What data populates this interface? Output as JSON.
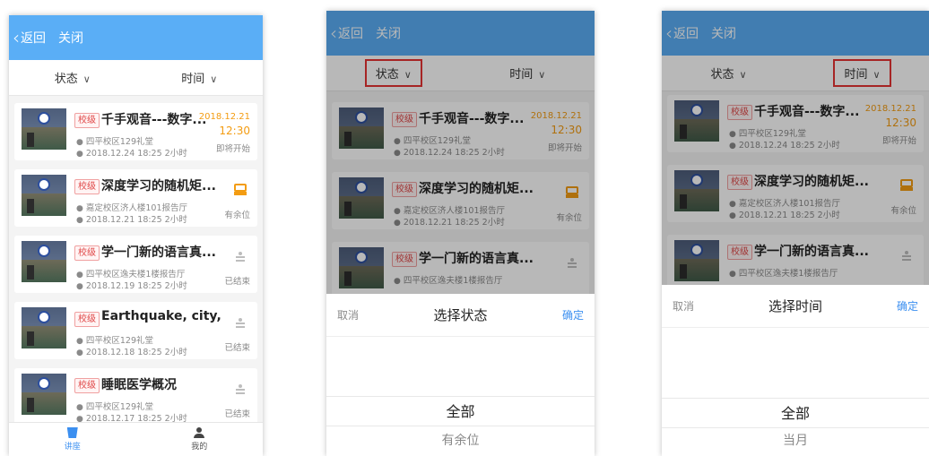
{
  "header": {
    "back_label": "返回",
    "close_label": "关闭"
  },
  "filters": {
    "status_label": "状态",
    "time_label": "时间",
    "arrow": "∨"
  },
  "highlight_color": "#e63232",
  "accent_color": "#5aaef6",
  "lectures": [
    {
      "tag": "校级",
      "title": "千手观音---数字...",
      "location": "四平校区129礼堂",
      "time": "2018.12.24 18:25 2小时",
      "date": "2018.12.21",
      "clock": "12:30",
      "status": "即将开始",
      "icon": "none"
    },
    {
      "tag": "校级",
      "title": "深度学习的随机矩...",
      "location": "嘉定校区济人楼101报告厅",
      "time": "2018.12.21 18:25 2小时",
      "status": "有余位",
      "icon": "seat-icon"
    },
    {
      "tag": "校级",
      "title": "学一门新的语言真...",
      "location": "四平校区逸夫楼1楼报告厅",
      "time": "2018.12.19 18:25 2小时",
      "status": "已结束",
      "icon": "ended-icon"
    },
    {
      "tag": "校级",
      "title": "Earthquake, city, ...",
      "location": "四平校区129礼堂",
      "time": "2018.12.18 18:25 2小时",
      "status": "已结束",
      "icon": "ended-icon"
    },
    {
      "tag": "校级",
      "title": "睡眠医学概况",
      "location": "四平校区129礼堂",
      "time": "2018.12.17 18:25 2小时",
      "status": "已结束",
      "icon": "ended-icon"
    }
  ],
  "tabbar": {
    "lecture_label": "讲座",
    "me_label": "我的"
  },
  "status_picker": {
    "cancel": "取消",
    "title": "选择状态",
    "confirm": "确定",
    "selected": "全部",
    "next": "有余位"
  },
  "time_picker": {
    "cancel": "取消",
    "title": "选择时间",
    "confirm": "确定",
    "selected": "全部",
    "next": "当月"
  }
}
